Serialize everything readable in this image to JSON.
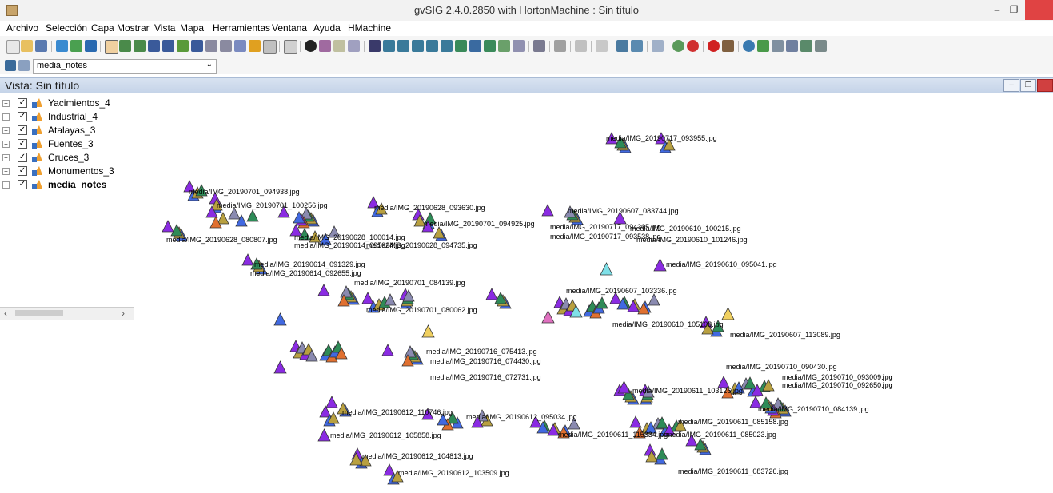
{
  "window": {
    "title": "gvSIG 2.4.0.2850 with HortonMachine : Sin título"
  },
  "menu": [
    "Archivo",
    "Selección",
    "Capa",
    "Mostrar",
    "Vista",
    "Mapa",
    "Herramientas",
    "Ventana",
    "Ayuda",
    "HMachine"
  ],
  "toolbar2": {
    "layer_selected": "media_notes"
  },
  "view": {
    "title": "Vista: Sin título"
  },
  "layers": [
    {
      "name": "Yacimientos_4",
      "checked": true,
      "bold": false
    },
    {
      "name": "Industrial_4",
      "checked": true,
      "bold": false
    },
    {
      "name": "Atalayas_3",
      "checked": true,
      "bold": false
    },
    {
      "name": "Fuentes_3",
      "checked": true,
      "bold": false
    },
    {
      "name": "Cruces_3",
      "checked": true,
      "bold": false
    },
    {
      "name": "Monumentos_3",
      "checked": true,
      "bold": false
    },
    {
      "name": "media_notes",
      "checked": true,
      "bold": true
    }
  ],
  "colors": {
    "purple": "#8a2be2",
    "blue": "#4169e1",
    "olive": "#b8a040",
    "green": "#2e8b57",
    "yellow": "#f0d060",
    "cyan": "#7fe0e8",
    "pink": "#e070c0",
    "gray": "#8a8ab0",
    "orange": "#e07030"
  },
  "map_labels": [
    "media/IMG_20190717_093955.jpg",
    "media/IMG_20190701_094938.jpg",
    "media/IMG_20190701_100256.jpg",
    "media/IMG_20190628_093630.jpg",
    "media/IMG_20190607_083744.jpg",
    "media/IMG_20190701_094925.jpg",
    "media/IMG_20190717_094305.jpg",
    "media/IMG_20190610_100215.jpg",
    "media/IMG_20190717_093538.jpg",
    "media/IMG_20190628_080807.jpg",
    "media/IMG_20190628_100014.jpg",
    "media/IMG_20190610_101246.jpg",
    "media/IMG_20190628_094735.jpg",
    "media/IMG_20190614_095024.jpg",
    "media/IMG_20190614_091329.jpg",
    "media/IMG_20190610_095041.jpg",
    "media/IMG_20190614_092655.jpg",
    "media/IMG_20190701_084139.jpg",
    "media/IMG_20190607_103336.jpg",
    "media/IMG_20190701_080062.jpg",
    "media/IMG_20190610_105108.jpg",
    "media/IMG_20190607_113089.jpg",
    "media/IMG_20190716_075413.jpg",
    "media/IMG_20190716_074430.jpg",
    "media/IMG_20190716_072731.jpg",
    "media/IMG_20190710_090430.jpg",
    "media/IMG_20190710_093009.jpg",
    "media/IMG_20190710_092650.jpg",
    "media/IMG_20190611_103126.jpg",
    "media/IMG_20190710_084139.jpg",
    "media/IMG_20190612_110746.jpg",
    "media/IMG_20190612_095034.jpg",
    "media/IMG_20190611_085158.jpg",
    "media/IMG_20190612_105858.jpg",
    "media/IMG_20190611_115334.jpg",
    "media/IMG_20190611_085023.jpg",
    "media/IMG_20190612_104813.jpg",
    "media/IMG_20190611_083726.jpg",
    "media/IMG_20190612_103509.jpg"
  ]
}
